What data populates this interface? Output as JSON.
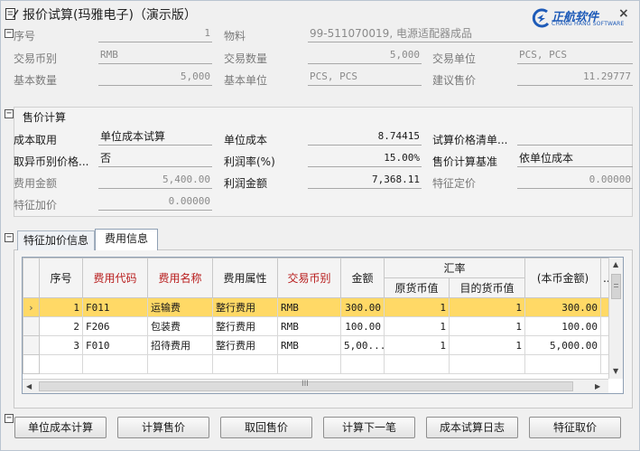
{
  "window": {
    "title": "报价试算(玛雅电子)（演示版）",
    "close_label": "×"
  },
  "logo": {
    "name": "正航软件",
    "subtitle": "CHANG HANG SOFTWARE"
  },
  "header": {
    "seq_label": "序号",
    "seq_value": "1",
    "material_label": "物料",
    "material_value": "99-511070019, 电源适配器成品",
    "currency_label": "交易币别",
    "currency_value": "RMB",
    "trade_qty_label": "交易数量",
    "trade_qty_value": "5,000",
    "trade_unit_label": "交易单位",
    "trade_unit_value": "PCS, PCS",
    "base_qty_label": "基本数量",
    "base_qty_value": "5,000",
    "base_unit_label": "基本单位",
    "base_unit_value": "PCS, PCS",
    "suggest_price_label": "建议售价",
    "suggest_price_value": "11.29777"
  },
  "calc": {
    "group_title": "售价计算",
    "cost_source_label": "成本取用",
    "cost_source_value": "单位成本试算",
    "unit_cost_label": "单位成本",
    "unit_cost_value": "8.74415",
    "price_list_label": "试算价格清单...",
    "price_list_value": "",
    "diff_currency_label": "取异币别价格...",
    "diff_currency_value": "否",
    "profit_rate_label": "利润率(%)",
    "profit_rate_value": "15.00%",
    "price_basis_label": "售价计算基准",
    "price_basis_value": "依单位成本",
    "expense_amount_label": "费用金额",
    "expense_amount_value": "5,400.00",
    "profit_amount_label": "利润金额",
    "profit_amount_value": "7,368.11",
    "feature_price_label": "特征定价",
    "feature_price_value": "0.00000",
    "feature_markup_label": "特征加价",
    "feature_markup_value": "0.00000"
  },
  "tabs": [
    {
      "label": "特征加价信息",
      "active": false
    },
    {
      "label": "费用信息",
      "active": true
    }
  ],
  "grid": {
    "headers": {
      "seq": "序号",
      "expense_code": "费用代码",
      "expense_name": "费用名称",
      "expense_attr": "费用属性",
      "currency": "交易币别",
      "amount": "金额",
      "exchange_rate": "汇率",
      "orig_currency": "原货币值",
      "target_currency": "目的货币值",
      "local_amount": "(本币金额)",
      "more": "..."
    },
    "rows": [
      {
        "seq": "1",
        "code": "F011",
        "name": "运输费",
        "attr": "整行费用",
        "currency": "RMB",
        "amount": "300.00",
        "orig": "1",
        "target": "1",
        "local": "300.00",
        "selected": true
      },
      {
        "seq": "2",
        "code": "F206",
        "name": "包装费",
        "attr": "整行费用",
        "currency": "RMB",
        "amount": "100.00",
        "orig": "1",
        "target": "1",
        "local": "100.00",
        "selected": false
      },
      {
        "seq": "3",
        "code": "F010",
        "name": "招待费用",
        "attr": "整行费用",
        "currency": "RMB",
        "amount": "5,00...",
        "orig": "1",
        "target": "1",
        "local": "5,000.00",
        "selected": false
      }
    ],
    "row_indicator": "›",
    "hscroll_grip": "III"
  },
  "buttons": {
    "unit_cost_calc": "单位成本计算",
    "calc_price": "计算售价",
    "retrieve_price": "取回售价",
    "calc_next": "计算下一笔",
    "cost_log": "成本试算日志",
    "feature_price": "特征取价"
  },
  "colors": {
    "selected_row": "#ffd966",
    "required_header": "#b81c1c",
    "brand": "#1e5bb8"
  }
}
